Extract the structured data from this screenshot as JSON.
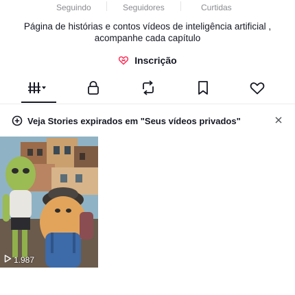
{
  "profile": {
    "stats": {
      "following_label": "Seguindo",
      "followers_label": "Seguidores",
      "likes_label": "Curtidas"
    },
    "bio": "Página de histórias e contos vídeos de inteligência artificial , acompanhe cada capítulo",
    "subscribe_label": "Inscrição"
  },
  "tabs": [
    {
      "icon": "videos-grid-icon",
      "active": true
    },
    {
      "icon": "lock-icon",
      "active": false
    },
    {
      "icon": "repost-icon",
      "active": false
    },
    {
      "icon": "bookmark-icon",
      "active": false
    },
    {
      "icon": "heart-icon",
      "active": false
    }
  ],
  "banner": {
    "text": "Veja Stories expirados em \"Seus vídeos privados\"",
    "icon": "add-circle-icon",
    "close_icon": "close-icon"
  },
  "videos": [
    {
      "views": "1.987",
      "icon": "play-icon"
    }
  ],
  "colors": {
    "text_primary": "#161823",
    "text_secondary": "#8a8b91",
    "subscribe_heart": "#fe2c55"
  }
}
